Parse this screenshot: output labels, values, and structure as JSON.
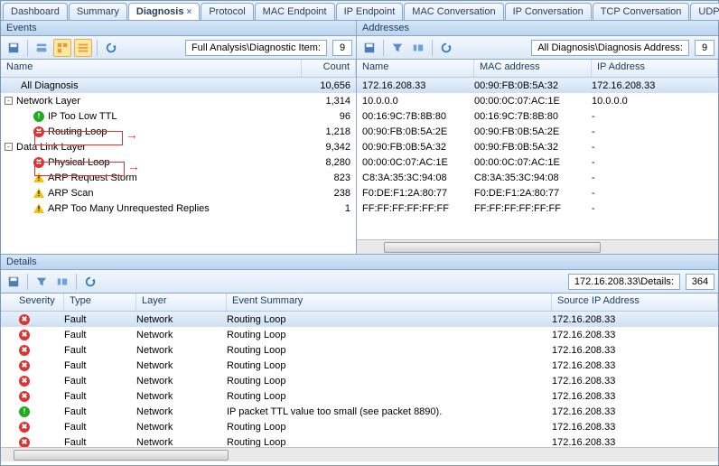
{
  "tabs": [
    "Dashboard",
    "Summary",
    "Diagnosis",
    "Protocol",
    "MAC Endpoint",
    "IP Endpoint",
    "MAC Conversation",
    "IP Conversation",
    "TCP Conversation",
    "UDP"
  ],
  "active_tab_index": 2,
  "events": {
    "title": "Events",
    "breadcrumb": "Full Analysis\\Diagnostic Item:",
    "breadcrumb_count": "9",
    "columns": {
      "name": "Name",
      "count": "Count"
    },
    "tree": [
      {
        "label": "All Diagnosis",
        "count": "10,656",
        "level": 0,
        "icon": "",
        "selected": true
      },
      {
        "label": "Network Layer",
        "count": "1,314",
        "level": 0,
        "icon": "",
        "expander": "-"
      },
      {
        "label": "IP Too Low TTL",
        "count": "96",
        "level": 1,
        "icon": "ok"
      },
      {
        "label": "Routing Loop",
        "count": "1,218",
        "level": 1,
        "icon": "err",
        "boxed": true
      },
      {
        "label": "Data Link Layer",
        "count": "9,342",
        "level": 0,
        "icon": "",
        "expander": "-"
      },
      {
        "label": "Physical Loop",
        "count": "8,280",
        "level": 1,
        "icon": "err",
        "boxed": true
      },
      {
        "label": "ARP Request Storm",
        "count": "823",
        "level": 1,
        "icon": "warn"
      },
      {
        "label": "ARP Scan",
        "count": "238",
        "level": 1,
        "icon": "warn"
      },
      {
        "label": "ARP Too Many Unrequested Replies",
        "count": "1",
        "level": 1,
        "icon": "warn"
      }
    ]
  },
  "addresses": {
    "title": "Addresses",
    "breadcrumb": "All Diagnosis\\Diagnosis Address:",
    "breadcrumb_count": "9",
    "columns": {
      "name": "Name",
      "mac": "MAC address",
      "ip": "IP Address"
    },
    "rows": [
      {
        "name": "172.16.208.33",
        "mac": "00:90:FB:0B:5A:32",
        "ip": "172.16.208.33",
        "selected": true
      },
      {
        "name": "10.0.0.0",
        "mac": "00:00:0C:07:AC:1E",
        "ip": "10.0.0.0"
      },
      {
        "name": "00:16:9C:7B:8B:80",
        "mac": "00:16:9C:7B:8B:80",
        "ip": "-"
      },
      {
        "name": "00:90:FB:0B:5A:2E",
        "mac": "00:90:FB:0B:5A:2E",
        "ip": "-"
      },
      {
        "name": "00:90:FB:0B:5A:32",
        "mac": "00:90:FB:0B:5A:32",
        "ip": "-"
      },
      {
        "name": "00:00:0C:07:AC:1E",
        "mac": "00:00:0C:07:AC:1E",
        "ip": "-"
      },
      {
        "name": "C8:3A:35:3C:94:08",
        "mac": "C8:3A:35:3C:94:08",
        "ip": "-"
      },
      {
        "name": "F0:DE:F1:2A:80:77",
        "mac": "F0:DE:F1:2A:80:77",
        "ip": "-"
      },
      {
        "name": "FF:FF:FF:FF:FF:FF",
        "mac": "FF:FF:FF:FF:FF:FF",
        "ip": "-"
      }
    ]
  },
  "details": {
    "title": "Details",
    "breadcrumb": "172.16.208.33\\Details:",
    "breadcrumb_count": "364",
    "columns": {
      "severity": "Severity",
      "type": "Type",
      "layer": "Layer",
      "summary": "Event Summary",
      "src": "Source IP Address"
    },
    "rows": [
      {
        "icon": "err",
        "type": "Fault",
        "layer": "Network",
        "summary": "Routing Loop",
        "src": "172.16.208.33",
        "selected": true
      },
      {
        "icon": "err",
        "type": "Fault",
        "layer": "Network",
        "summary": "Routing Loop",
        "src": "172.16.208.33"
      },
      {
        "icon": "err",
        "type": "Fault",
        "layer": "Network",
        "summary": "Routing Loop",
        "src": "172.16.208.33"
      },
      {
        "icon": "err",
        "type": "Fault",
        "layer": "Network",
        "summary": "Routing Loop",
        "src": "172.16.208.33"
      },
      {
        "icon": "err",
        "type": "Fault",
        "layer": "Network",
        "summary": "Routing Loop",
        "src": "172.16.208.33"
      },
      {
        "icon": "err",
        "type": "Fault",
        "layer": "Network",
        "summary": "Routing Loop",
        "src": "172.16.208.33"
      },
      {
        "icon": "ok",
        "type": "Fault",
        "layer": "Network",
        "summary": "IP packet TTL value too small (see packet 8890).",
        "src": "172.16.208.33"
      },
      {
        "icon": "err",
        "type": "Fault",
        "layer": "Network",
        "summary": "Routing Loop",
        "src": "172.16.208.33"
      },
      {
        "icon": "err",
        "type": "Fault",
        "layer": "Network",
        "summary": "Routing Loop",
        "src": "172.16.208.33"
      }
    ]
  }
}
